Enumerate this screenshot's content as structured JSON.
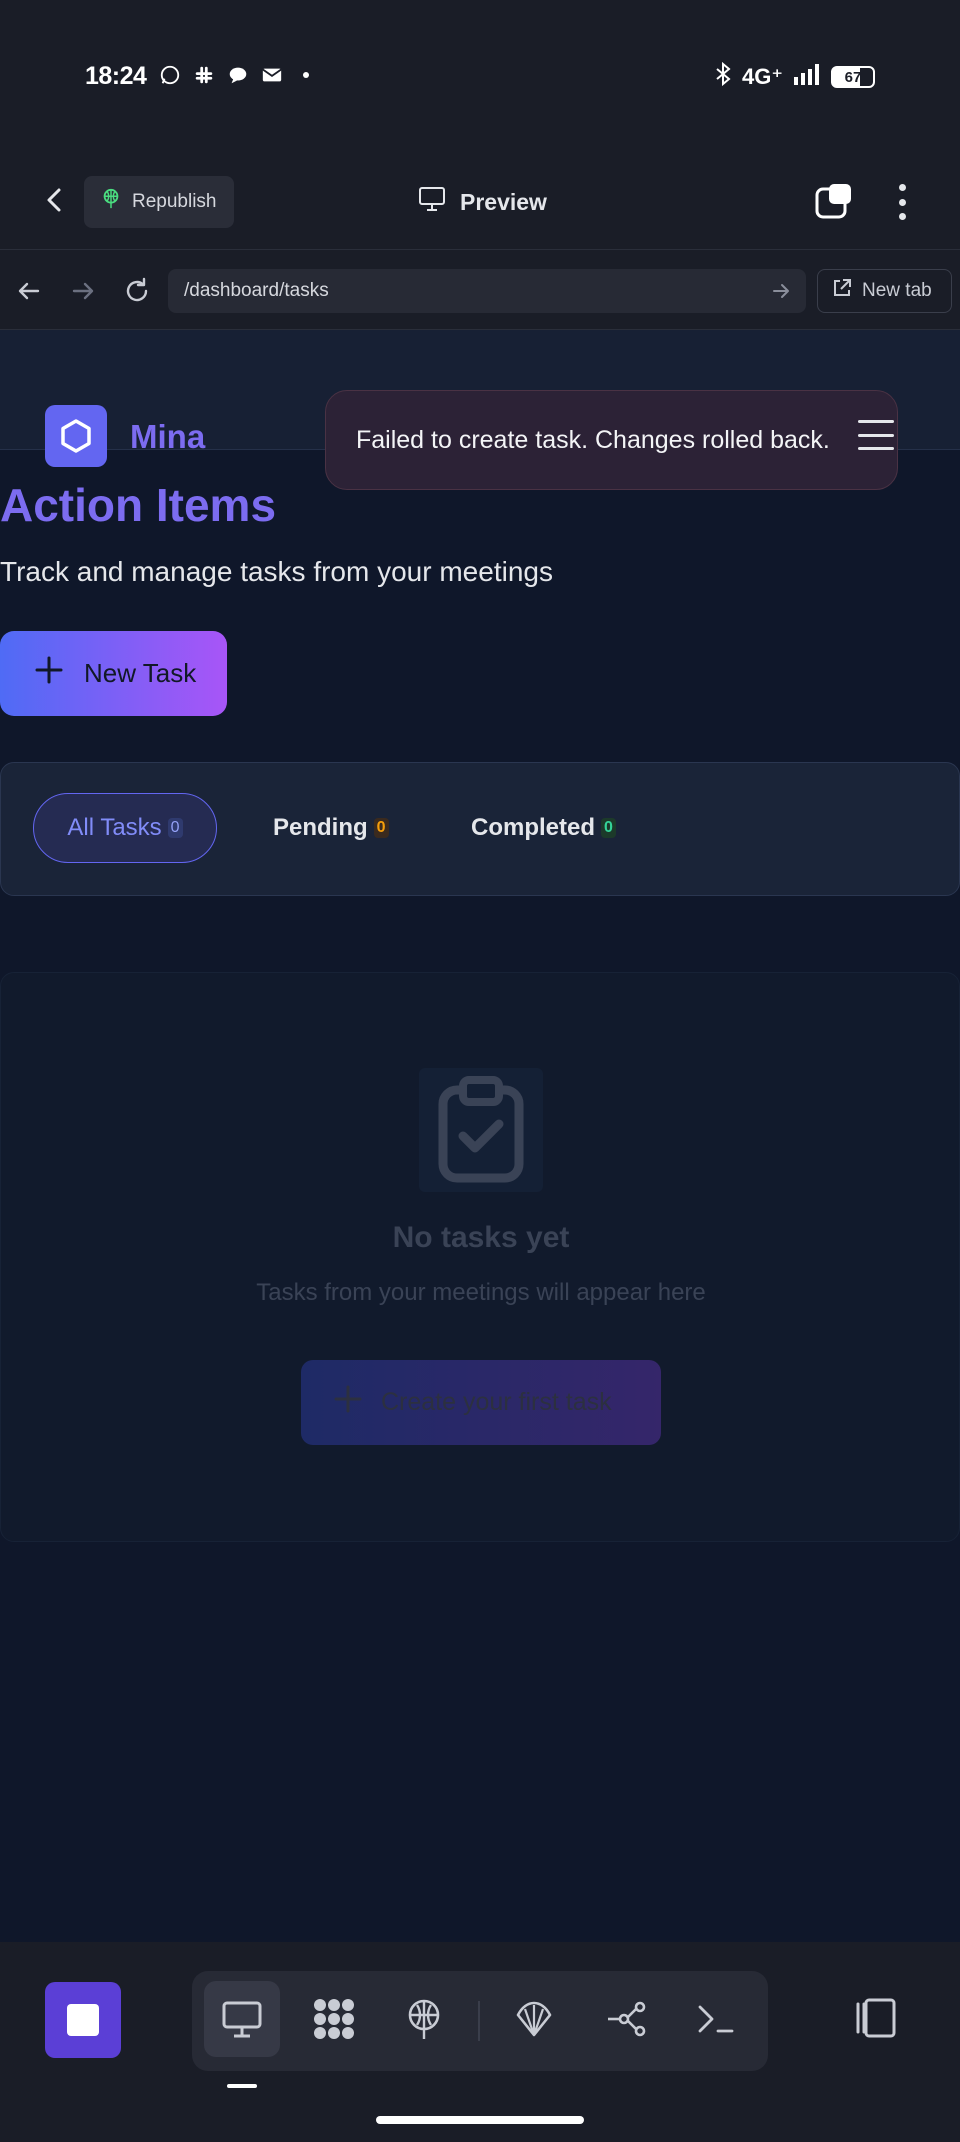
{
  "status_bar": {
    "time": "18:24",
    "network": "4G⁺",
    "battery": "67",
    "left_icons": [
      "whatsapp-icon",
      "slack-icon",
      "chat-icon",
      "mail-icon",
      "dot-icon"
    ]
  },
  "toolbar": {
    "republish_label": "Republish",
    "preview_label": "Preview"
  },
  "url_bar": {
    "url": "/dashboard/tasks",
    "new_tab_label": "New tab"
  },
  "app": {
    "brand": "Mina",
    "accent": "#7c6cf0"
  },
  "toast": {
    "message": "Failed to create task. Changes rolled back."
  },
  "main": {
    "title": "Action Items",
    "subtitle": "Track and manage tasks from your meetings",
    "new_task_label": "New Task",
    "filters": [
      {
        "label": "All Tasks",
        "count": "0"
      },
      {
        "label": "Pending",
        "count": "0"
      },
      {
        "label": "Completed",
        "count": "0"
      }
    ],
    "empty": {
      "title": "No tasks yet",
      "subtitle": "Tasks from your meetings will appear here",
      "cta_label": "Create your first task"
    }
  },
  "dock": {
    "items": [
      "monitor-icon",
      "apps-icon",
      "deploy-icon",
      "shell-icon",
      "graph-icon",
      "terminal-icon"
    ]
  }
}
